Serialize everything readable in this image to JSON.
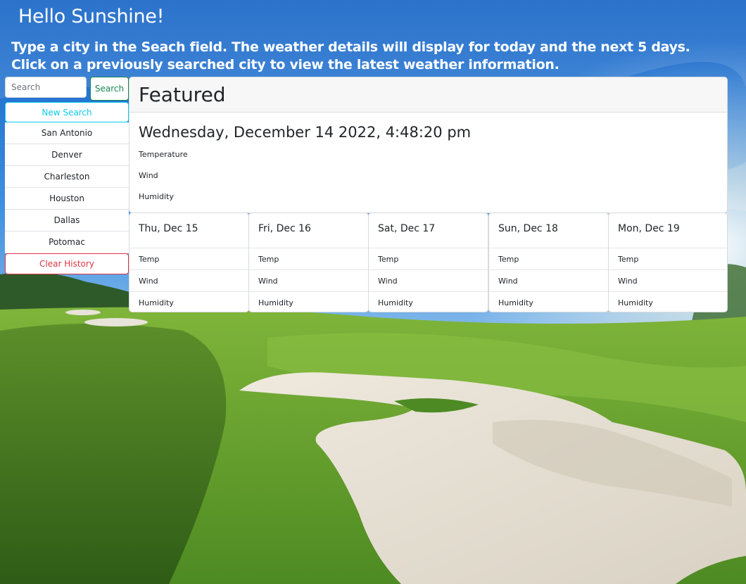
{
  "header": {
    "greeting": "Hello Sunshine!",
    "instructions": "Type a city in the Seach field. The weather details will display for today and the next 5 days. Click on a previously searched city to view the latest weather information."
  },
  "search": {
    "placeholder": "Search",
    "value": "",
    "button_label": "Search"
  },
  "sidebar": {
    "new_search_label": "New Search",
    "cities": [
      "San Antonio",
      "Denver",
      "Charleston",
      "Houston",
      "Dallas",
      "Potomac"
    ],
    "clear_label": "Clear History"
  },
  "featured": {
    "title": "Featured",
    "date": "Wednesday, December 14 2022, 4:48:20 pm",
    "temperature_label": "Temperature",
    "wind_label": "Wind",
    "humidity_label": "Humidity"
  },
  "forecast": [
    {
      "day": "Thu, Dec 15",
      "temp_label": "Temp",
      "wind_label": "Wind",
      "humidity_label": "Humidity"
    },
    {
      "day": "Fri, Dec 16",
      "temp_label": "Temp",
      "wind_label": "Wind",
      "humidity_label": "Humidity"
    },
    {
      "day": "Sat, Dec 17",
      "temp_label": "Temp",
      "wind_label": "Wind",
      "humidity_label": "Humidity"
    },
    {
      "day": "Sun, Dec 18",
      "temp_label": "Temp",
      "wind_label": "Wind",
      "humidity_label": "Humidity"
    },
    {
      "day": "Mon, Dec 19",
      "temp_label": "Temp",
      "wind_label": "Wind",
      "humidity_label": "Humidity"
    }
  ],
  "colors": {
    "search_button": "#198754",
    "new_search_button": "#0dcaf0",
    "clear_button": "#dc3545",
    "sky": "#1f6fcf",
    "grass": "#5a9a2c",
    "sand": "#e6e1d6"
  }
}
